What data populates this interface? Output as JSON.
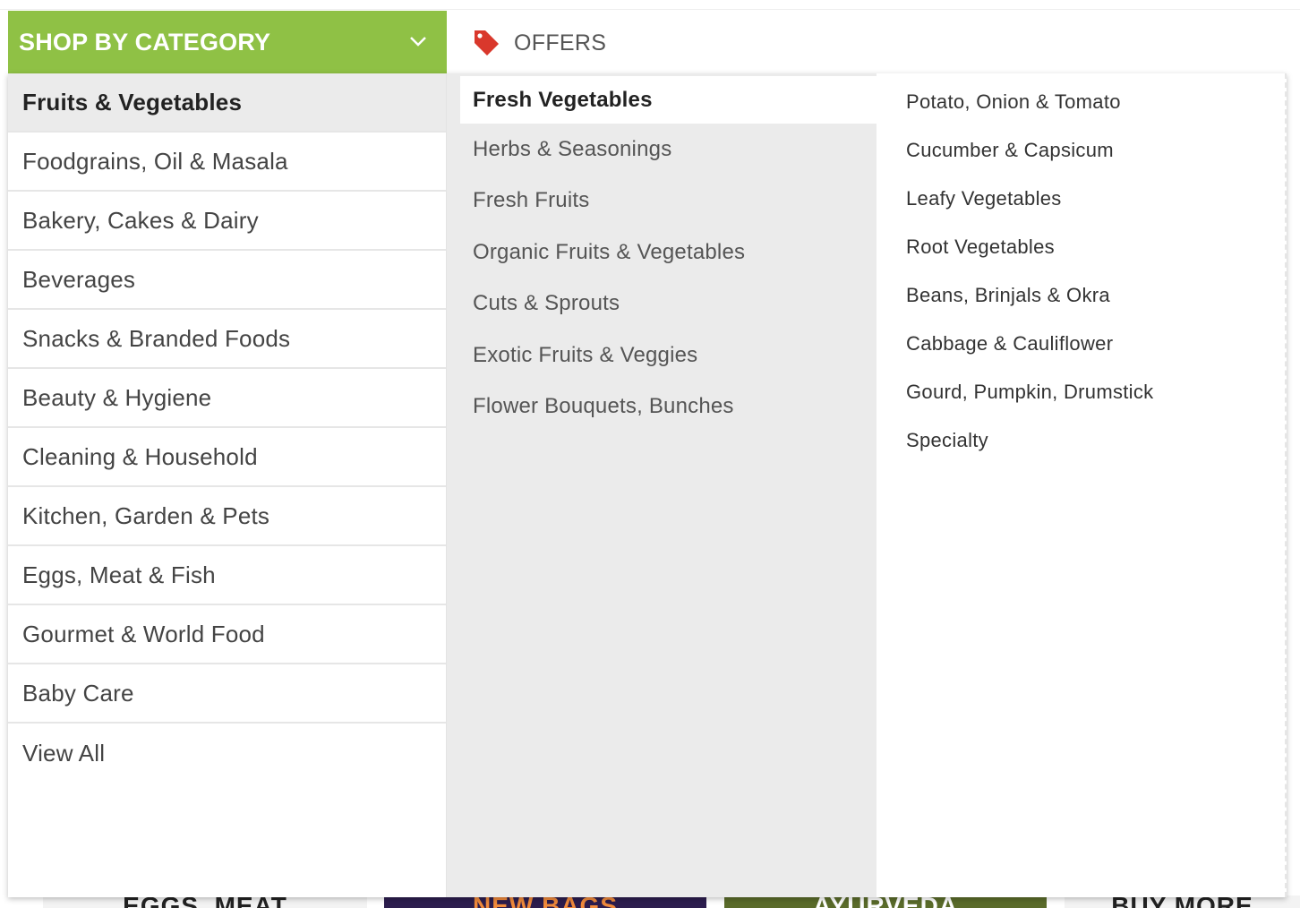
{
  "header": {
    "shop_label": "SHOP BY CATEGORY",
    "offers_label": "OFFERS",
    "accent_color": "#8fc145",
    "offer_tag_color": "#d9382c"
  },
  "categories": [
    "Fruits & Vegetables",
    "Foodgrains, Oil & Masala",
    "Bakery, Cakes & Dairy",
    "Beverages",
    "Snacks & Branded Foods",
    "Beauty & Hygiene",
    "Cleaning & Household",
    "Kitchen, Garden & Pets",
    "Eggs, Meat & Fish",
    "Gourmet & World Food",
    "Baby Care",
    "View All"
  ],
  "subcategories": [
    "Fresh Vegetables",
    "Herbs & Seasonings",
    "Fresh Fruits",
    "Organic Fruits & Vegetables",
    "Cuts & Sprouts",
    "Exotic Fruits & Veggies",
    "Flower Bouquets, Bunches"
  ],
  "items": [
    "Potato, Onion & Tomato",
    "Cucumber & Capsicum",
    "Leafy Vegetables",
    "Root Vegetables",
    "Beans, Brinjals & Okra",
    "Cabbage & Cauliflower",
    "Gourd, Pumpkin, Drumstick",
    "Specialty"
  ],
  "banners": [
    "EGGS, MEAT",
    "NEW BAGS",
    "AYURVEDA",
    "BUY MORE"
  ]
}
